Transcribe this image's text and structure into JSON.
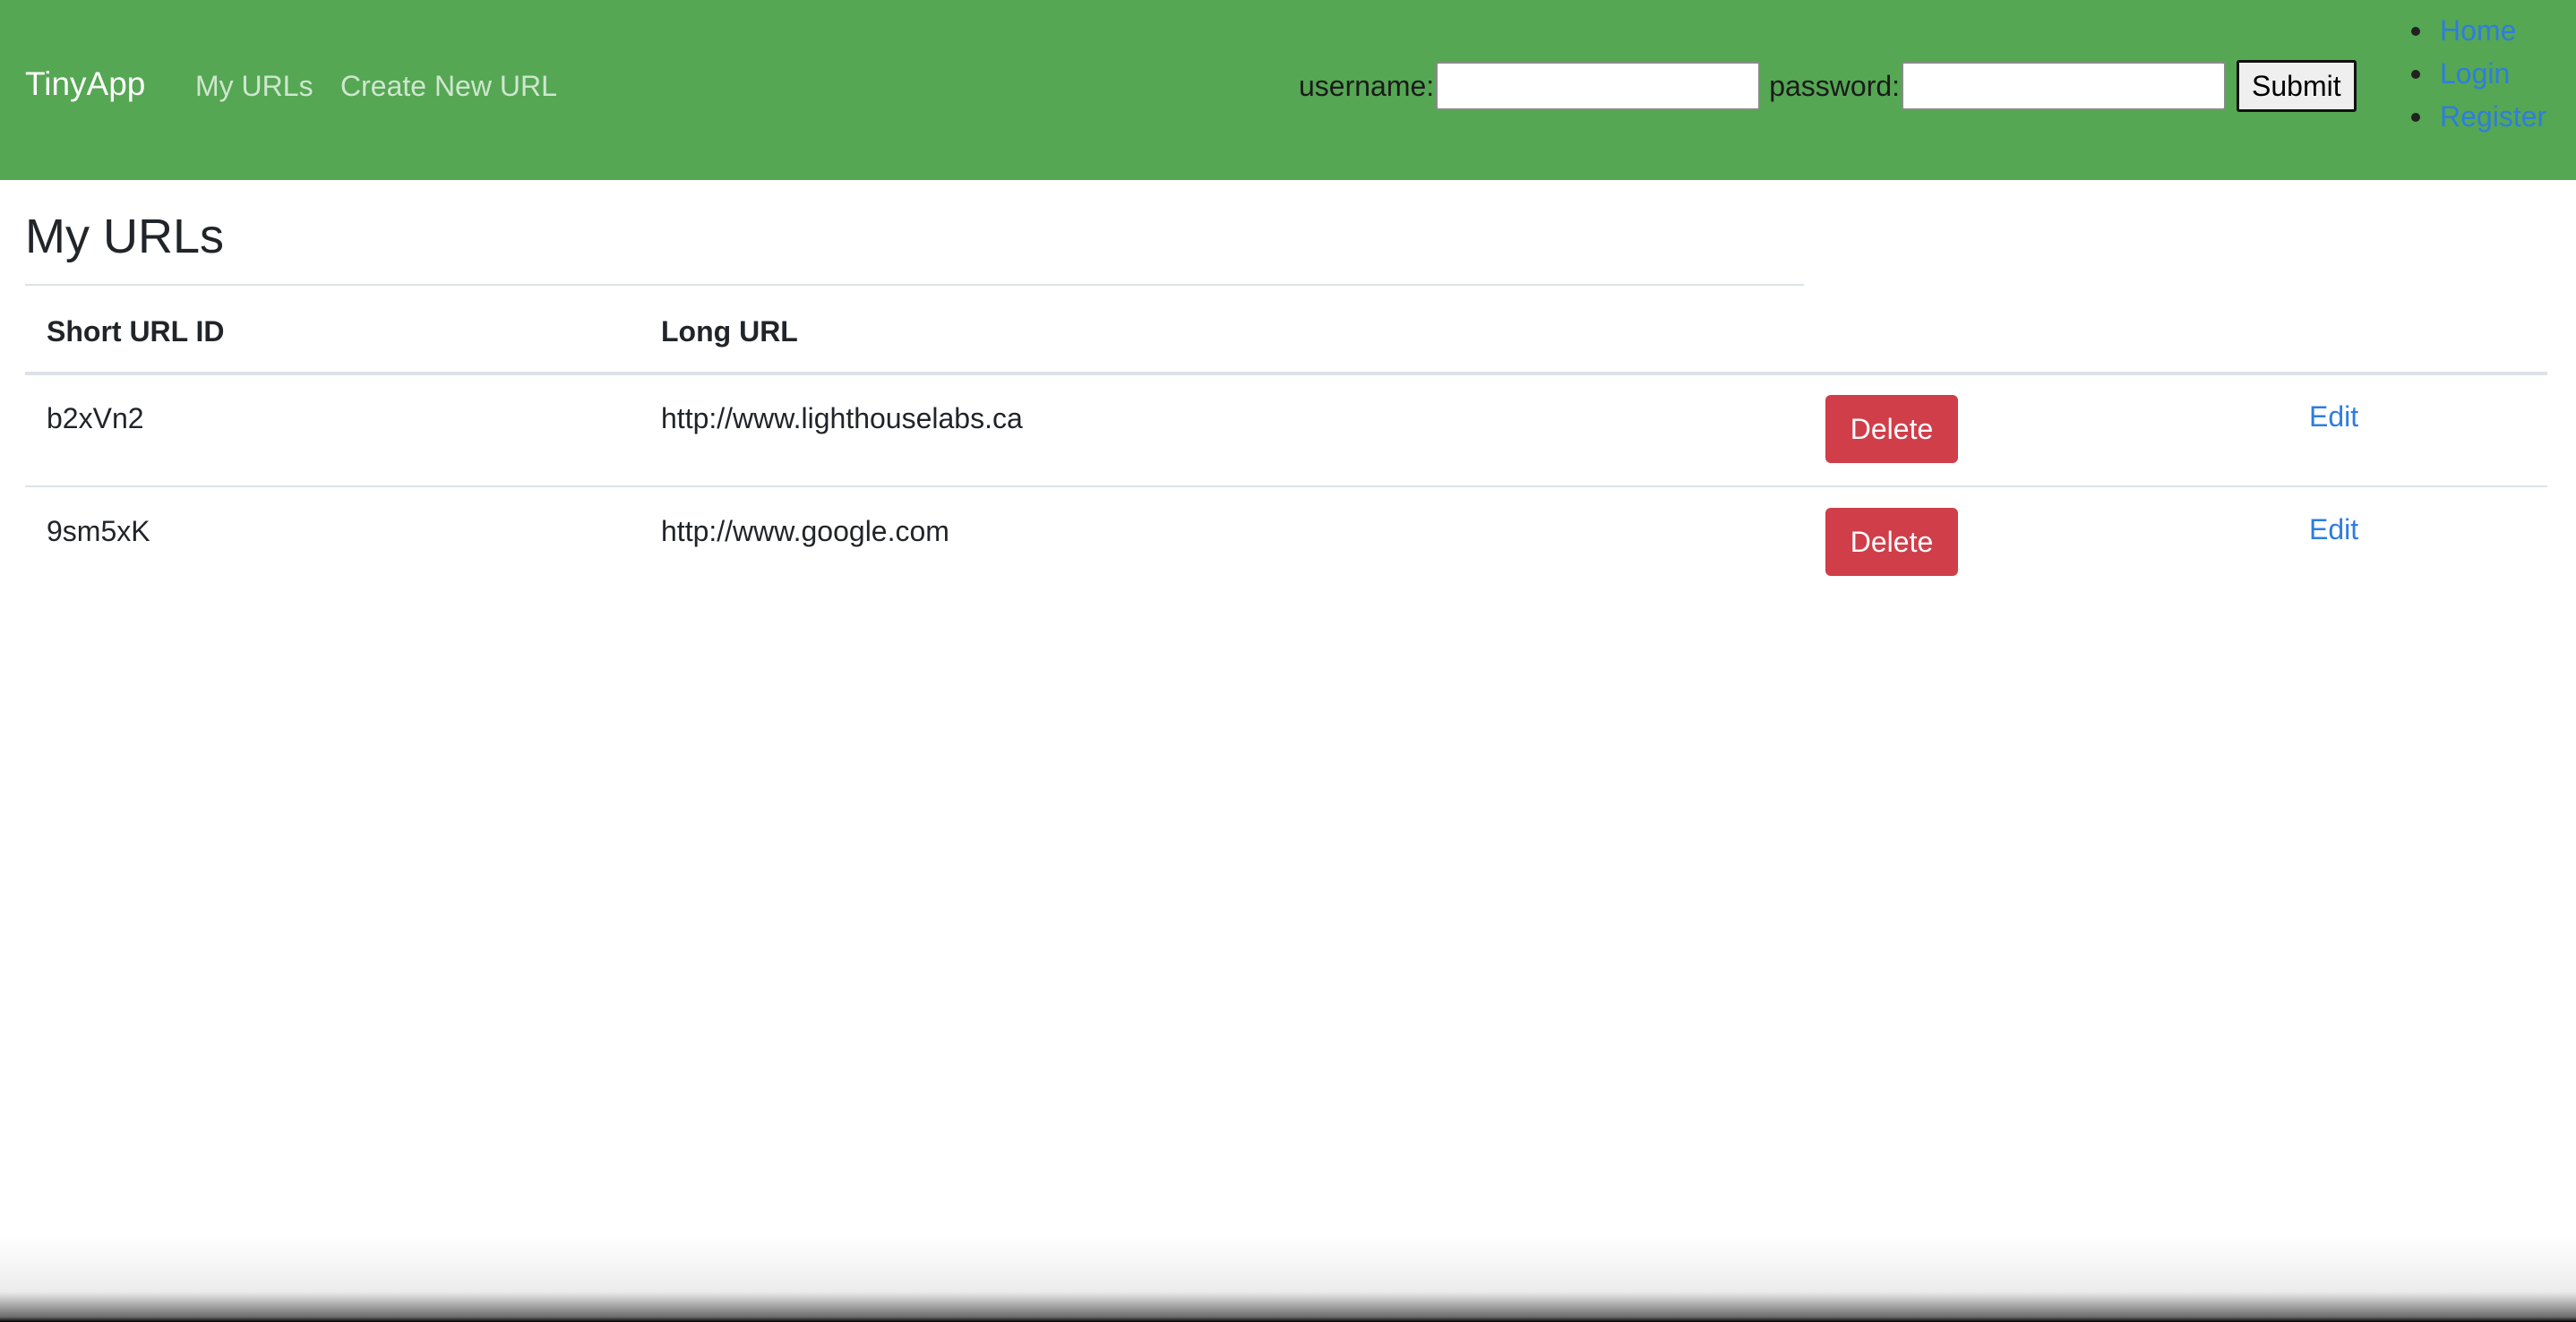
{
  "navbar": {
    "brand": "TinyApp",
    "links": [
      "My URLs",
      "Create New URL"
    ],
    "login": {
      "username_label": "username:",
      "username_value": "",
      "password_label": "password:",
      "password_value": "",
      "submit_label": "Submit"
    },
    "side_links": [
      "Home",
      "Login",
      "Register"
    ]
  },
  "colors": {
    "navbar_bg": "#55a753",
    "delete_button": "#cf3e49",
    "link": "#2e7de0"
  },
  "main": {
    "title": "My URLs",
    "table": {
      "headers": [
        "Short URL ID",
        "Long URL"
      ],
      "rows": [
        {
          "short_id": "b2xVn2",
          "long_url": "http://www.lighthouselabs.ca",
          "delete_label": "Delete",
          "edit_label": "Edit"
        },
        {
          "short_id": "9sm5xK",
          "long_url": "http://www.google.com",
          "delete_label": "Delete",
          "edit_label": "Edit"
        }
      ]
    }
  }
}
